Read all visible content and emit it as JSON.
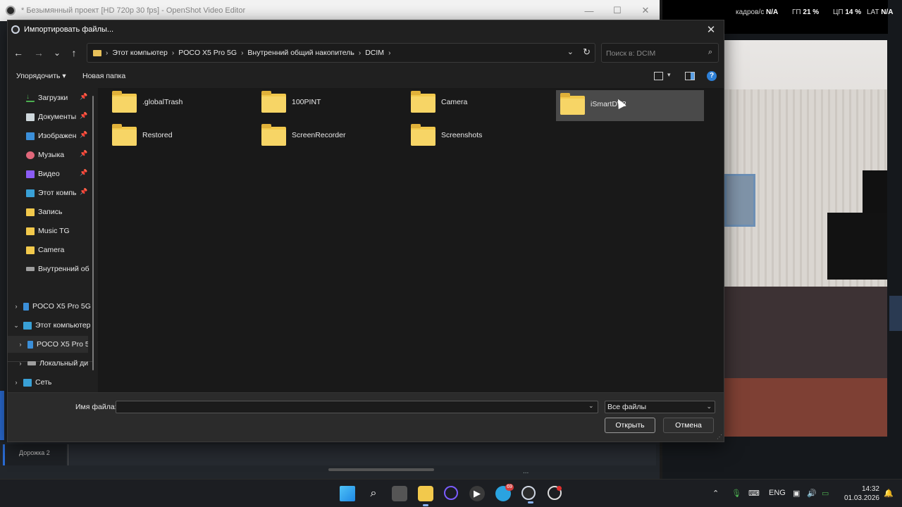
{
  "os_window": {
    "title": "* Безымянный проект [HD 720p 30 fps] - OpenShot Video Editor",
    "minimize": "—",
    "maximize": "☐",
    "close": "✕",
    "track_label": "Дорожка 2",
    "status_text": "..."
  },
  "hud": {
    "fps_label": "кадров/с",
    "fps_value": "N/A",
    "gpu_label": "ГП",
    "gpu_value": "21 %",
    "cpu_label": "ЦП",
    "cpu_value": "14 %",
    "lat_label": "LAT",
    "lat_value": "N/A"
  },
  "dialog": {
    "title": "Импортировать файлы...",
    "close": "✕",
    "nav": {
      "back": "←",
      "forward": "→",
      "recent": "⌄",
      "up": "↑"
    },
    "breadcrumbs": [
      "Этот компьютер",
      "POCO X5 Pro 5G",
      "Внутренний общий накопитель",
      "DCIM"
    ],
    "search_placeholder": "Поиск в: DCIM",
    "toolbar": {
      "organize": "Упорядочить ▾",
      "new_folder": "Новая папка"
    },
    "nav_pane": [
      {
        "label": "Загрузки",
        "icon": "download-icon",
        "pinned": true
      },
      {
        "label": "Документы",
        "icon": "documents-icon",
        "pinned": true
      },
      {
        "label": "Изображен",
        "icon": "pictures-icon",
        "pinned": true
      },
      {
        "label": "Музыка",
        "icon": "music-icon",
        "pinned": true
      },
      {
        "label": "Видео",
        "icon": "video-icon",
        "pinned": true
      },
      {
        "label": "Этот компь",
        "icon": "monitor-icon",
        "pinned": true
      },
      {
        "label": "Запись",
        "icon": "folder-icon",
        "pinned": false
      },
      {
        "label": "Music TG",
        "icon": "folder-icon",
        "pinned": false
      },
      {
        "label": "Camera",
        "icon": "folder-icon",
        "pinned": false
      },
      {
        "label": "Внутренний об",
        "icon": "drive-icon",
        "pinned": false
      }
    ],
    "nav_tree": [
      {
        "label": "POCO X5 Pro 5G",
        "icon": "phone-icon",
        "chev": "›"
      },
      {
        "label": "Этот компьютер",
        "icon": "monitor-icon",
        "chev": "⌄"
      },
      {
        "label": "POCO X5 Pro 5",
        "icon": "phone-icon",
        "chev": "›"
      },
      {
        "label": "Локальный ди",
        "icon": "drive-icon",
        "chev": "›"
      },
      {
        "label": "Сеть",
        "icon": "network-icon",
        "chev": "›"
      }
    ],
    "files": [
      ".globalTrash",
      "100PINT",
      "Camera",
      "iSmartDV2",
      "Restored",
      "ScreenRecorder",
      "Screenshots"
    ],
    "hovered_file": "iSmartDV2",
    "footer": {
      "filename_label": "Имя файла:",
      "filename_value": "",
      "filetype": "Все файлы",
      "open": "Открыть",
      "cancel": "Отмена"
    }
  },
  "taskbar": {
    "tray_lang": "ENG",
    "time": "14:32",
    "date": "01.03.2026",
    "telegram_badge": "69"
  },
  "colors": {
    "accent": "#2d7fd6",
    "folder": "#f2c94c",
    "dialog_bg": "#202020"
  }
}
